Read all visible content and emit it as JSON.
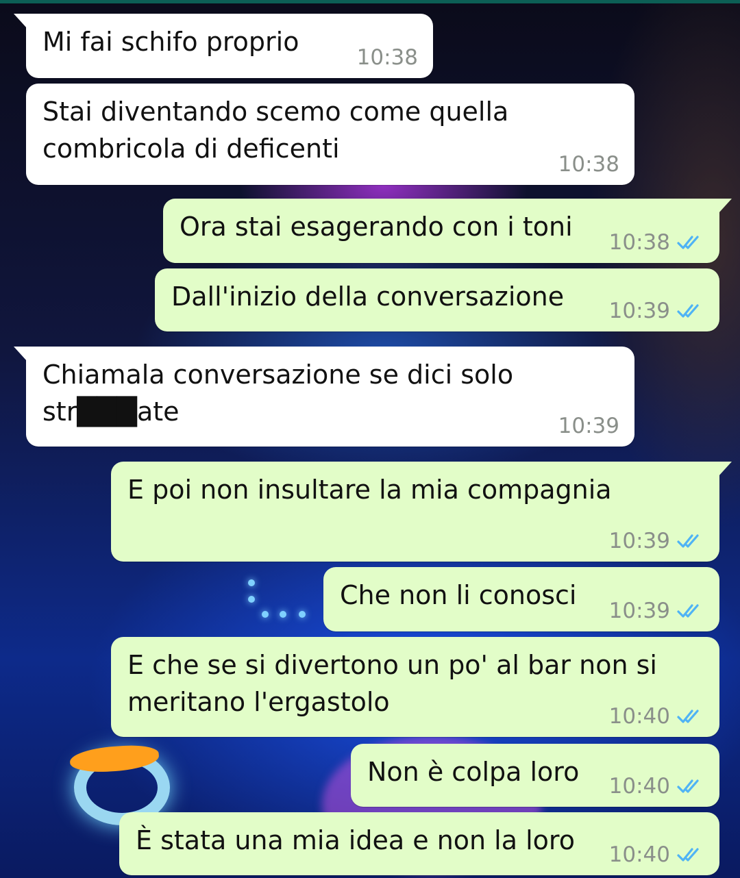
{
  "messages": [
    {
      "dir": "in",
      "text": "Mi fai schifo proprio",
      "time": "10:38"
    },
    {
      "dir": "in",
      "text": "Stai diventando scemo come quella combricola di deficenti",
      "time": "10:38"
    },
    {
      "dir": "out",
      "text": "Ora stai esagerando con i toni",
      "time": "10:38"
    },
    {
      "dir": "out",
      "text": "Dall'inizio della conversazione",
      "time": "10:39"
    },
    {
      "dir": "in",
      "text": "Chiamala conversazione se dici solo str███ate",
      "time": "10:39"
    },
    {
      "dir": "out",
      "text": "E poi non insultare la mia compagnia",
      "time": "10:39"
    },
    {
      "dir": "out",
      "text": "Che non li conosci",
      "time": "10:39"
    },
    {
      "dir": "out",
      "text": "E che se si divertono un po' al bar non si meritano l'ergastolo",
      "time": "10:40"
    },
    {
      "dir": "out",
      "text": "Non è colpa loro",
      "time": "10:40"
    },
    {
      "dir": "out",
      "text": "È stata una mia idea e non la loro",
      "time": "10:40"
    }
  ],
  "colors": {
    "incoming_bubble": "#ffffff",
    "outgoing_bubble": "#e2fdc8",
    "read_ticks": "#4fb3f5",
    "timestamp": "#8a8f8a"
  },
  "icons": {
    "read_status": "double-check-icon",
    "redaction": "redaction-scribble"
  }
}
